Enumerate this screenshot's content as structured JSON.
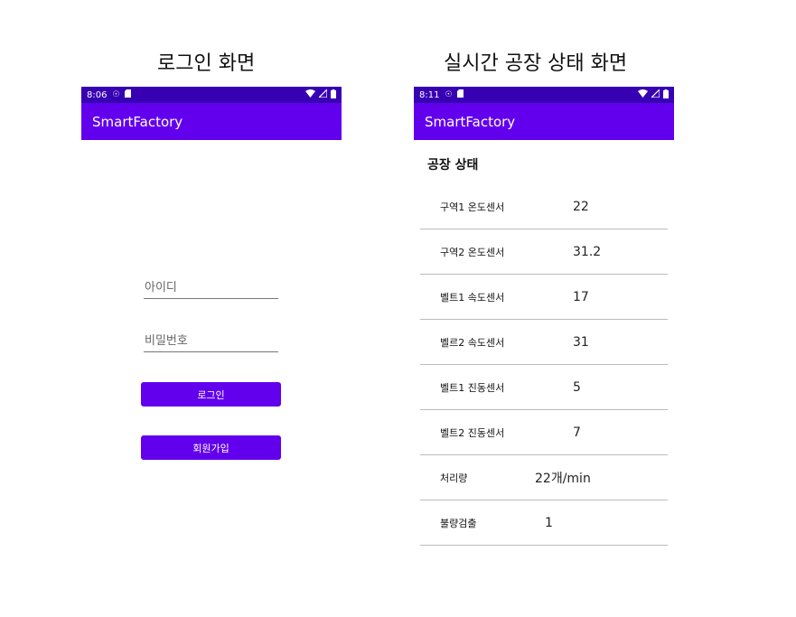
{
  "captions": {
    "login": "로그인 화면",
    "status": "실시간 공장 상태 화면"
  },
  "login_screen": {
    "status_time": "8:06",
    "app_title": "SmartFactory",
    "id_placeholder": "아이디",
    "password_placeholder": "비밀번호",
    "login_button": "로그인",
    "signup_button": "회원가입"
  },
  "status_screen": {
    "status_time": "8:11",
    "app_title": "SmartFactory",
    "section_title": "공장 상태",
    "rows": [
      {
        "label": "구역1 온도센서",
        "value": "22"
      },
      {
        "label": "구역2 온도센서",
        "value": "31.2"
      },
      {
        "label": "벨트1 속도센서",
        "value": "17"
      },
      {
        "label": "벨르2 속도센서",
        "value": "31"
      },
      {
        "label": "벨트1 진동센서",
        "value": "5"
      },
      {
        "label": "벨트2 진동센서",
        "value": "7"
      },
      {
        "label": "처리량",
        "value": "22개/min"
      },
      {
        "label": "불량검출",
        "value": "1"
      }
    ]
  },
  "icons": [
    "data-saver-icon",
    "sd-card-icon",
    "wifi-icon",
    "signal-icon",
    "battery-icon"
  ],
  "colors": {
    "status_bar": "#3700b3",
    "app_bar": "#6200ee",
    "button": "#6200ee"
  }
}
